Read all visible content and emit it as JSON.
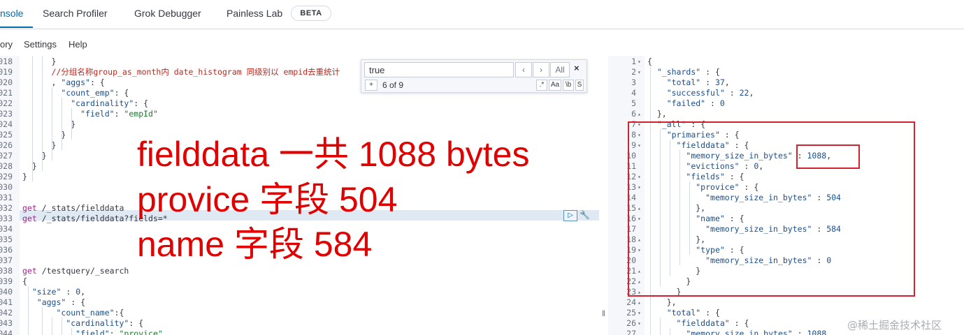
{
  "tabs": [
    {
      "label": "nsole"
    },
    {
      "label": "Search Profiler"
    },
    {
      "label": "Grok Debugger"
    },
    {
      "label": "Painless Lab"
    }
  ],
  "beta_badge": "BETA",
  "menu": [
    {
      "label": "ory"
    },
    {
      "label": "Settings"
    },
    {
      "label": "Help"
    }
  ],
  "search": {
    "value": "true",
    "prev_label": "‹",
    "next_label": "›",
    "all_label": "All",
    "close_label": "×",
    "add_label": "+",
    "count": "6 of 9",
    "regex_label": ".*",
    "case_label": "Aa",
    "word_label": "\\b",
    "selection_label": "S"
  },
  "left_lines": [
    {
      "n": "018",
      "fold": "",
      "code": "      }"
    },
    {
      "n": "019",
      "fold": "",
      "code": "      //分组名称group_as_month内 date_histogram 同级别以 empid去重统计"
    },
    {
      "n": "020",
      "fold": "",
      "code": "      , \"aggs\": {"
    },
    {
      "n": "021",
      "fold": "",
      "code": "        \"count_emp\": {"
    },
    {
      "n": "022",
      "fold": "",
      "code": "          \"cardinality\": {"
    },
    {
      "n": "023",
      "fold": "",
      "code": "            \"field\": \"empId\""
    },
    {
      "n": "024",
      "fold": "",
      "code": "          }"
    },
    {
      "n": "025",
      "fold": "",
      "code": "        }"
    },
    {
      "n": "026",
      "fold": "",
      "code": "      }"
    },
    {
      "n": "027",
      "fold": "",
      "code": "    }"
    },
    {
      "n": "028",
      "fold": "",
      "code": "  }"
    },
    {
      "n": "029",
      "fold": "",
      "code": "}"
    },
    {
      "n": "030",
      "fold": "",
      "code": ""
    },
    {
      "n": "031",
      "fold": "",
      "code": ""
    },
    {
      "n": "032",
      "fold": "",
      "code": "get /_stats/fielddata"
    },
    {
      "n": "033",
      "fold": "",
      "code": "get /_stats/fielddata?fields=*"
    },
    {
      "n": "034",
      "fold": "",
      "code": ""
    },
    {
      "n": "035",
      "fold": "",
      "code": ""
    },
    {
      "n": "036",
      "fold": "",
      "code": ""
    },
    {
      "n": "037",
      "fold": "",
      "code": ""
    },
    {
      "n": "038",
      "fold": "",
      "code": "get /testquery/_search"
    },
    {
      "n": "039",
      "fold": "",
      "code": "{"
    },
    {
      "n": "040",
      "fold": "",
      "code": "  \"size\" : 0,"
    },
    {
      "n": "041",
      "fold": "",
      "code": "   \"aggs\" : {"
    },
    {
      "n": "042",
      "fold": "",
      "code": "       \"count_name\":{"
    },
    {
      "n": "043",
      "fold": "",
      "code": "         \"cardinality\": {"
    },
    {
      "n": "044",
      "fold": "",
      "code": "           \"field\": \"provice\""
    }
  ],
  "right_lines": [
    {
      "n": "1",
      "code": "{"
    },
    {
      "n": "2",
      "code": "  \"_shards\" : {"
    },
    {
      "n": "3",
      "code": "    \"total\" : 37,"
    },
    {
      "n": "4",
      "code": "    \"successful\" : 22,"
    },
    {
      "n": "5",
      "code": "    \"failed\" : 0"
    },
    {
      "n": "6",
      "code": "  },"
    },
    {
      "n": "7",
      "code": "  \"_all\" : {"
    },
    {
      "n": "8",
      "code": "    \"primaries\" : {"
    },
    {
      "n": "9",
      "code": "      \"fielddata\" : {"
    },
    {
      "n": "10",
      "code": "        \"memory_size_in_bytes\" : 1088,"
    },
    {
      "n": "11",
      "code": "        \"evictions\" : 0,"
    },
    {
      "n": "12",
      "code": "        \"fields\" : {"
    },
    {
      "n": "13",
      "code": "          \"provice\" : {"
    },
    {
      "n": "14",
      "code": "            \"memory_size_in_bytes\" : 504"
    },
    {
      "n": "15",
      "code": "          },"
    },
    {
      "n": "16",
      "code": "          \"name\" : {"
    },
    {
      "n": "17",
      "code": "            \"memory_size_in_bytes\" : 584"
    },
    {
      "n": "18",
      "code": "          },"
    },
    {
      "n": "19",
      "code": "          \"type\" : {"
    },
    {
      "n": "20",
      "code": "            \"memory_size_in_bytes\" : 0"
    },
    {
      "n": "21",
      "code": "          }"
    },
    {
      "n": "22",
      "code": "        }"
    },
    {
      "n": "23",
      "code": "      }"
    },
    {
      "n": "24",
      "code": "    },"
    },
    {
      "n": "25",
      "code": "    \"total\" : {"
    },
    {
      "n": "26",
      "code": "      \"fielddata\" : {"
    },
    {
      "n": "27",
      "code": "        \"memory_size_in_bytes\" : 1088,"
    }
  ],
  "overlay": {
    "line1": "fielddata 一共 1088 bytes",
    "line2": "provice 字段 504",
    "line3": "name 字段 584"
  },
  "watermark": "@稀土掘金技术社区",
  "colors": {
    "accent": "#006bb4",
    "annotation_red": "#e00000",
    "box_red": "#d3222e",
    "comment": "#bd271e"
  },
  "icons": {
    "run": "play-icon",
    "wrench": "wrench-icon",
    "close": "close-icon",
    "resizer": "drag-handle-icon"
  }
}
